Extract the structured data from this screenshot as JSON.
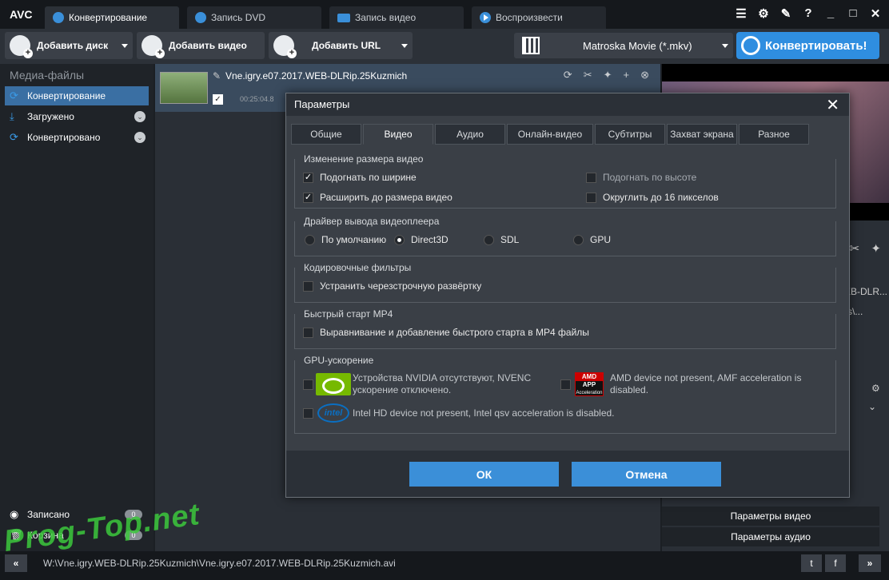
{
  "app": {
    "logo": "AVC",
    "tabs": [
      {
        "label": "Конвертирование"
      },
      {
        "label": "Запись DVD"
      },
      {
        "label": "Запись видео"
      },
      {
        "label": "Воспроизвести"
      }
    ],
    "window_controls": [
      "?",
      "_",
      "□",
      "✕"
    ]
  },
  "toolbar": {
    "add_disc": "Добавить диск",
    "add_video": "Добавить видео",
    "add_url": "Добавить URL",
    "format": "Matroska Movie (*.mkv)",
    "convert": "Конвертировать!"
  },
  "sidebar": {
    "title": "Медиа-файлы",
    "items": [
      {
        "label": "Конвертирование"
      },
      {
        "label": "Загружено"
      },
      {
        "label": "Конвертировано"
      }
    ],
    "bottom_items": [
      {
        "label": "Записано",
        "count": "0"
      },
      {
        "label": "Корзина",
        "count": "0"
      }
    ]
  },
  "file": {
    "name": "Vne.igry.e07.2017.WEB-DLRip.25Kuzmich",
    "duration": "00:25:04.8"
  },
  "right_panel": {
    "partial_name": "EB-DLR...",
    "partial_path": "s\\...",
    "video_params": "Параметры видео",
    "audio_params": "Параметры аудио"
  },
  "status": {
    "path": "W:\\Vne.igry.WEB-DLRip.25Kuzmich\\Vne.igry.e07.2017.WEB-DLRip.25Kuzmich.avi"
  },
  "watermark": "Prog-Top.net",
  "dialog": {
    "title": "Параметры",
    "tabs": [
      "Общие",
      "Видео",
      "Аудио",
      "Онлайн-видео",
      "Субтитры",
      "Захват экрана",
      "Разное"
    ],
    "resize": {
      "label": "Изменение размера видео",
      "fit_width": "Подогнать по ширине",
      "fit_height": "Подогнать по высоте",
      "expand": "Расширить до размера видео",
      "round16": "Округлить до 16 пикселов"
    },
    "driver": {
      "label": "Драйвер вывода видеоплеера",
      "default": "По умолчанию",
      "direct3d": "Direct3D",
      "sdl": "SDL",
      "gpu": "GPU"
    },
    "filters": {
      "label": "Кодировочные фильтры",
      "deinterlace": "Устранить черезстрочную развёртку"
    },
    "mp4": {
      "label": "Быстрый старт MP4",
      "faststart": "Выравнивание и добавление быстрого старта в MP4 файлы"
    },
    "gpu_accel": {
      "label": "GPU-ускорение",
      "nvidia_line1": "Устройства NVIDIA отсутствуют, NVENC",
      "nvidia_line2": "ускорение отключено.",
      "amd_line1": "AMD device not present, AMF acceleration is",
      "amd_line2": "disabled.",
      "intel": "Intel HD device not present, Intel qsv acceleration is disabled.",
      "amd_logo_top": "AMD",
      "amd_logo_mid": "APP",
      "amd_logo_bottom": "Acceleration",
      "intel_logo": "intel"
    },
    "ok": "ОК",
    "cancel": "Отмена"
  }
}
